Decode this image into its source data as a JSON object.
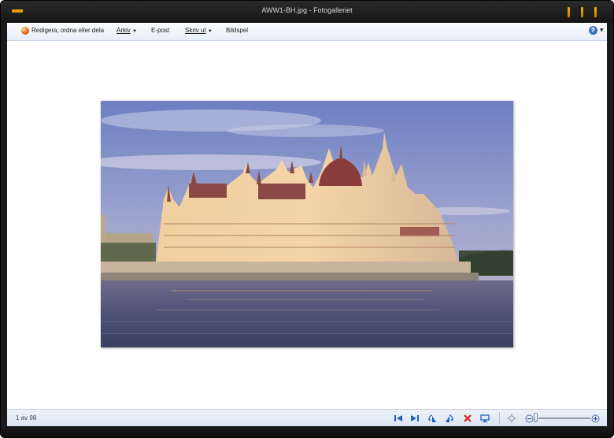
{
  "window": {
    "title": "AWW1-BH.jpg - Fotogalleriet"
  },
  "toolbar": {
    "edit_label": "Redigera, ordna eller dela",
    "file_label": "Arkiv",
    "email_label": "E-post",
    "print_label": "Skriv ut",
    "slideshow_label": "Bildspel"
  },
  "statusbar": {
    "counter": "1 av 98"
  },
  "colors": {
    "accent": "#f3b000",
    "delete_red": "#d81e1e",
    "nav_blue": "#1f5fbf"
  },
  "icons": [
    "app-menu-icon",
    "gallery-icon",
    "help-icon",
    "previous-icon",
    "next-icon",
    "rotate-left-icon",
    "rotate-right-icon",
    "delete-icon",
    "slideshow-icon",
    "actual-size-icon",
    "zoom-out-icon",
    "zoom-in-icon"
  ]
}
